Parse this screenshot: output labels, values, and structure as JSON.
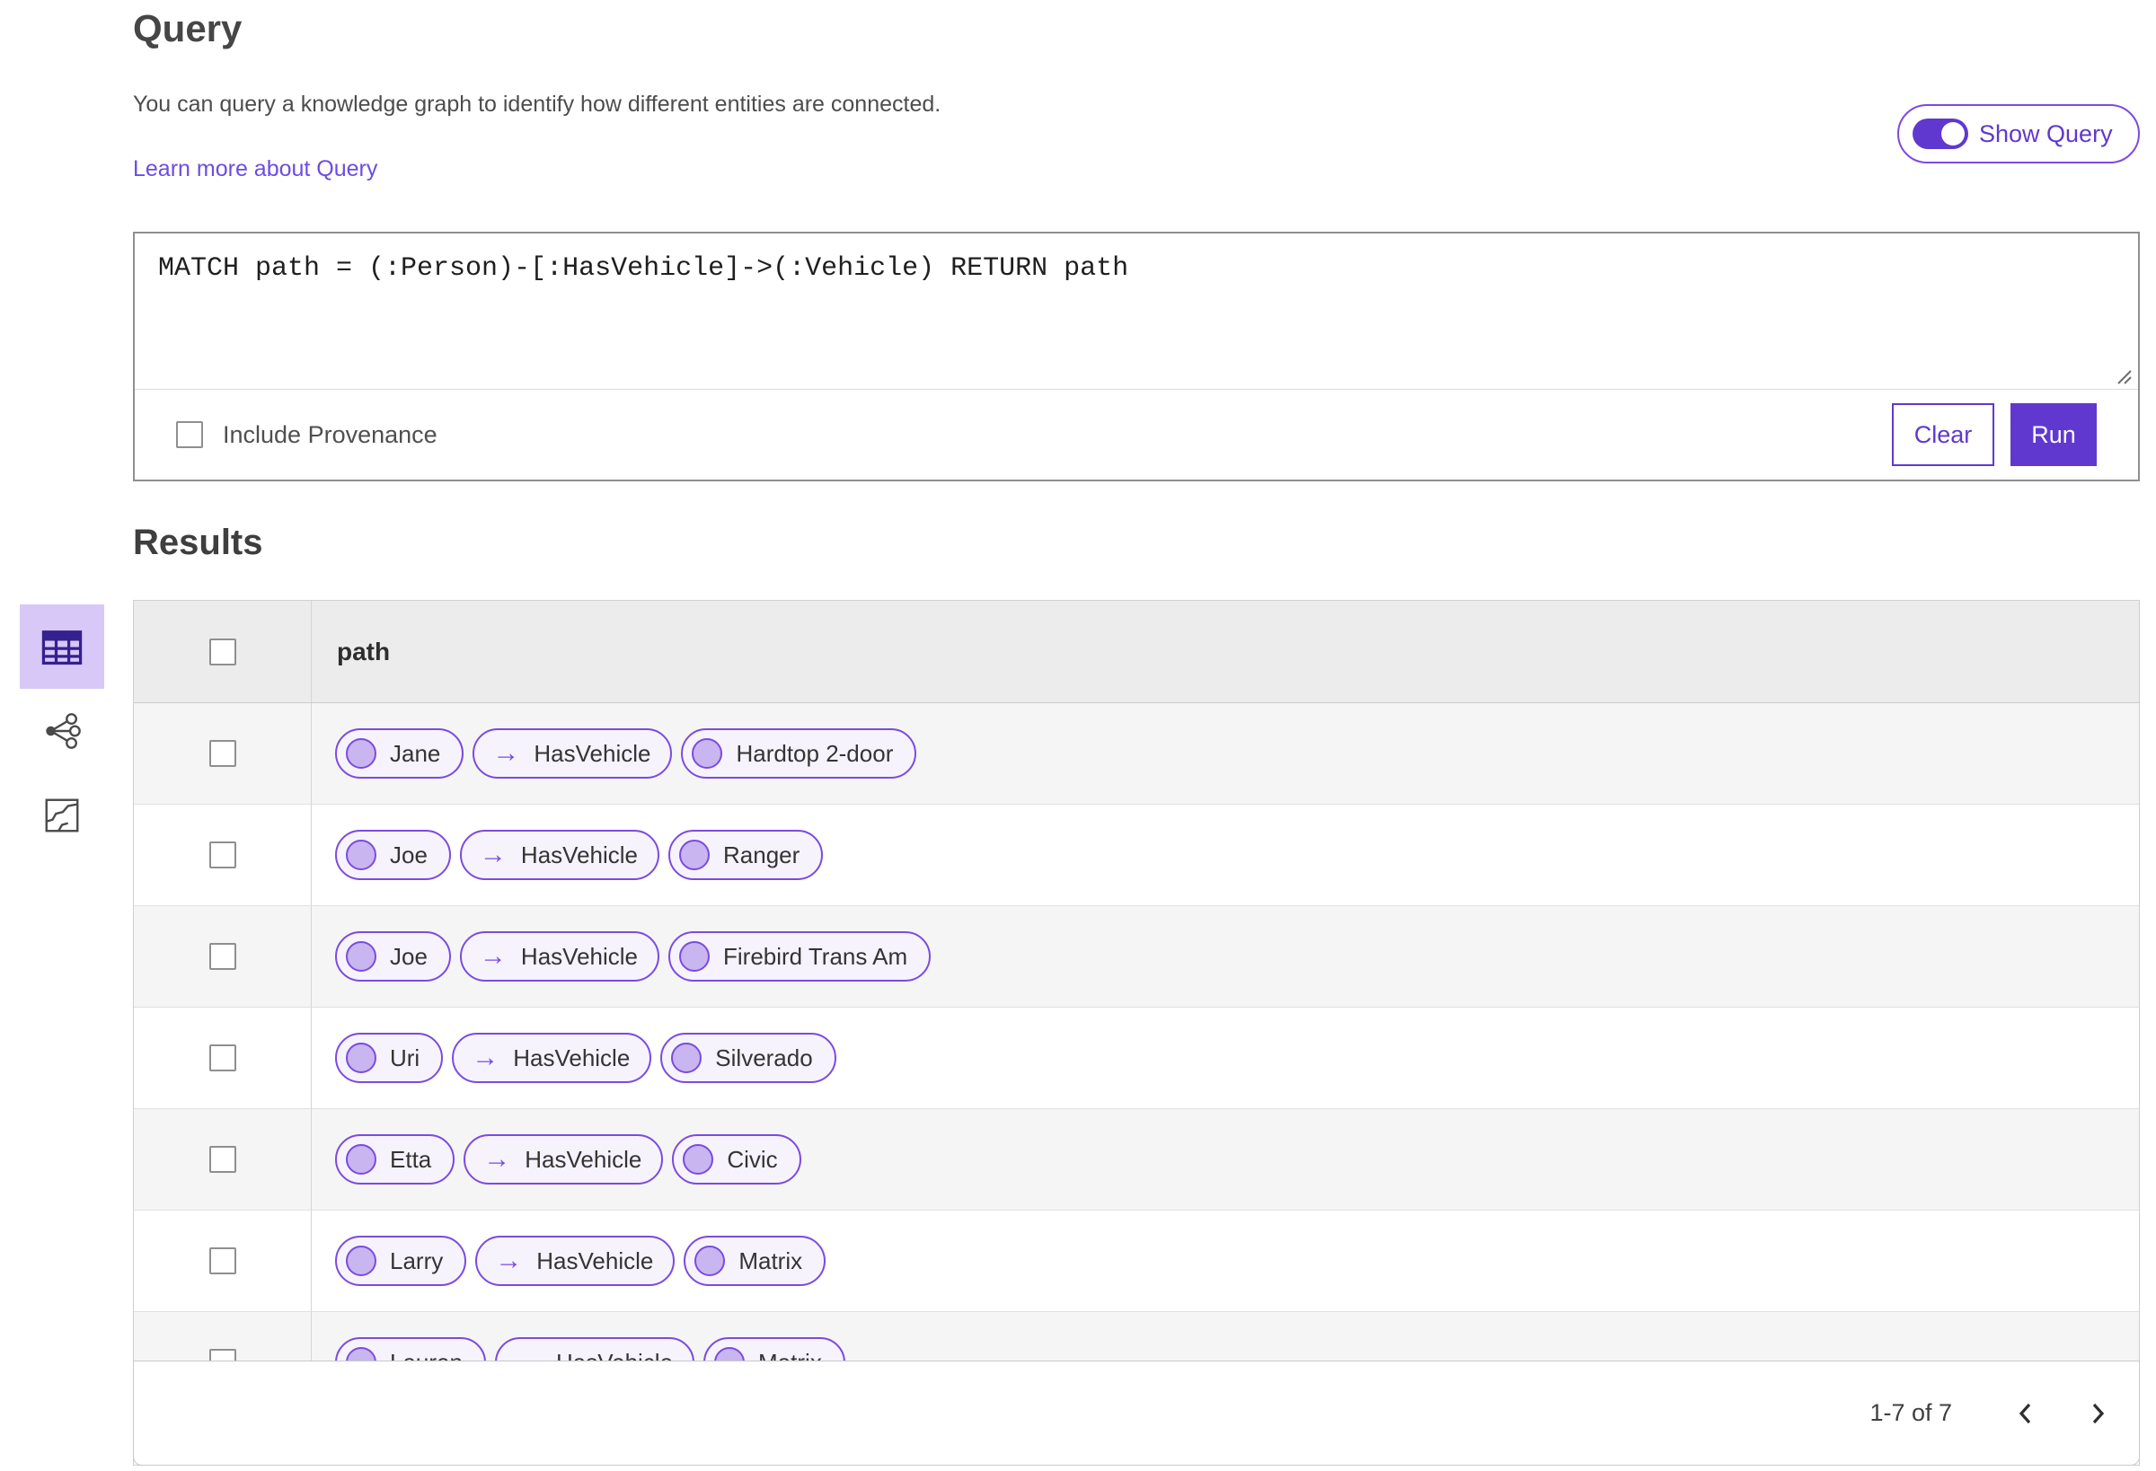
{
  "colors": {
    "accent": "#6038cf",
    "pill-border": "#7b4be0",
    "pill-bg": "#f6f3fd",
    "node-fill": "#c9b5f0",
    "link": "#6a4de4",
    "selected-bg": "#d7c8f8",
    "selected-icon": "#35208f"
  },
  "icons": {
    "arrow_right": "→"
  },
  "header": {
    "title": "Query",
    "description": "You can query a knowledge graph to identify how different entities are connected.",
    "learn_more_label": "Learn more about Query",
    "show_query_label": "Show Query",
    "show_query_on": true
  },
  "query_panel": {
    "query_text": "MATCH path = (:Person)-[:HasVehicle]->(:Vehicle) RETURN path",
    "include_provenance_label": "Include Provenance",
    "include_provenance_checked": false,
    "clear_label": "Clear",
    "run_label": "Run"
  },
  "results": {
    "title": "Results",
    "views": [
      {
        "name": "table-view",
        "selected": true
      },
      {
        "name": "link-chart-view",
        "selected": false
      },
      {
        "name": "map-view",
        "selected": false
      }
    ],
    "table": {
      "column_header": "path",
      "select_all_checked": false,
      "rows": [
        {
          "person": "Jane",
          "relation": "HasVehicle",
          "vehicle": "Hardtop 2-door"
        },
        {
          "person": "Joe",
          "relation": "HasVehicle",
          "vehicle": "Ranger"
        },
        {
          "person": "Joe",
          "relation": "HasVehicle",
          "vehicle": "Firebird Trans Am"
        },
        {
          "person": "Uri",
          "relation": "HasVehicle",
          "vehicle": "Silverado"
        },
        {
          "person": "Etta",
          "relation": "HasVehicle",
          "vehicle": "Civic"
        },
        {
          "person": "Larry",
          "relation": "HasVehicle",
          "vehicle": "Matrix"
        },
        {
          "person": "Lauren",
          "relation": "HasVehicle",
          "vehicle": "Matrix"
        }
      ]
    },
    "pagination": {
      "range_label": "1-7 of 7"
    }
  }
}
